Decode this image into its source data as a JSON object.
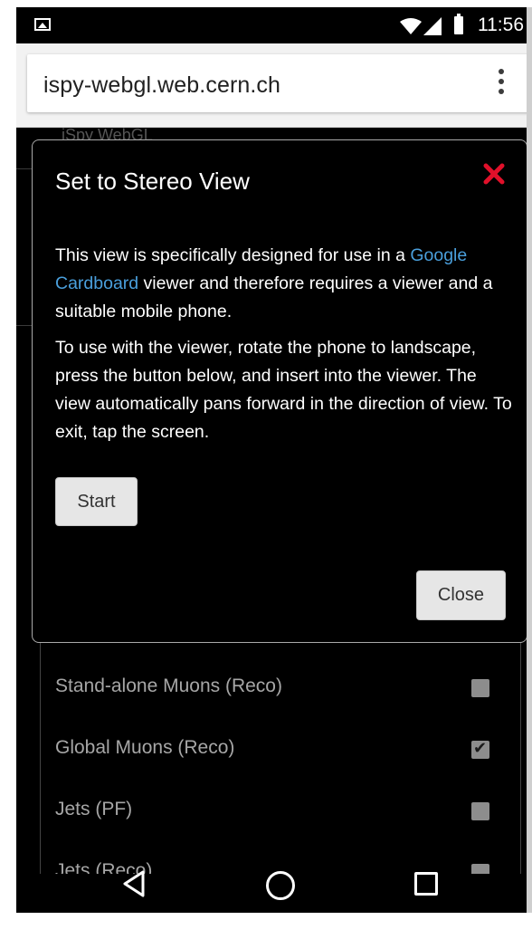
{
  "status_bar": {
    "time": "11:56",
    "icons": [
      "image-notification-icon",
      "wifi-icon",
      "signal-icon",
      "battery-icon"
    ]
  },
  "browser": {
    "url": "ispy-webgl.web.cern.ch",
    "menu_icon": "overflow-menu-icon"
  },
  "page": {
    "app_title": "iSpy WebGL",
    "settings": [
      {
        "label": "Stand-alone Muons (Reco)",
        "checked": false
      },
      {
        "label": "Global Muons (Reco)",
        "checked": true
      },
      {
        "label": "Jets (PF)",
        "checked": false
      },
      {
        "label": "Jets (Reco)",
        "checked": false
      }
    ]
  },
  "modal": {
    "title": "Set to Stereo View",
    "close_icon": "close-x-icon",
    "close_icon_color": "#e0102a",
    "paragraph1_before": "This view is specifically designed for use in a ",
    "paragraph1_link": "Google Cardboard",
    "paragraph1_after": " viewer and therefore requires a viewer and a suitable mobile phone.",
    "paragraph2": "To use with the viewer, rotate the phone to landscape, press the button below, and insert into the viewer. The view automatically pans forward in the direction of view. To exit, tap the screen.",
    "start_label": "Start",
    "close_label": "Close",
    "link_color": "#4a9fdc"
  },
  "nav_bar": {
    "icons": [
      "back-icon",
      "home-icon",
      "recents-icon"
    ]
  }
}
